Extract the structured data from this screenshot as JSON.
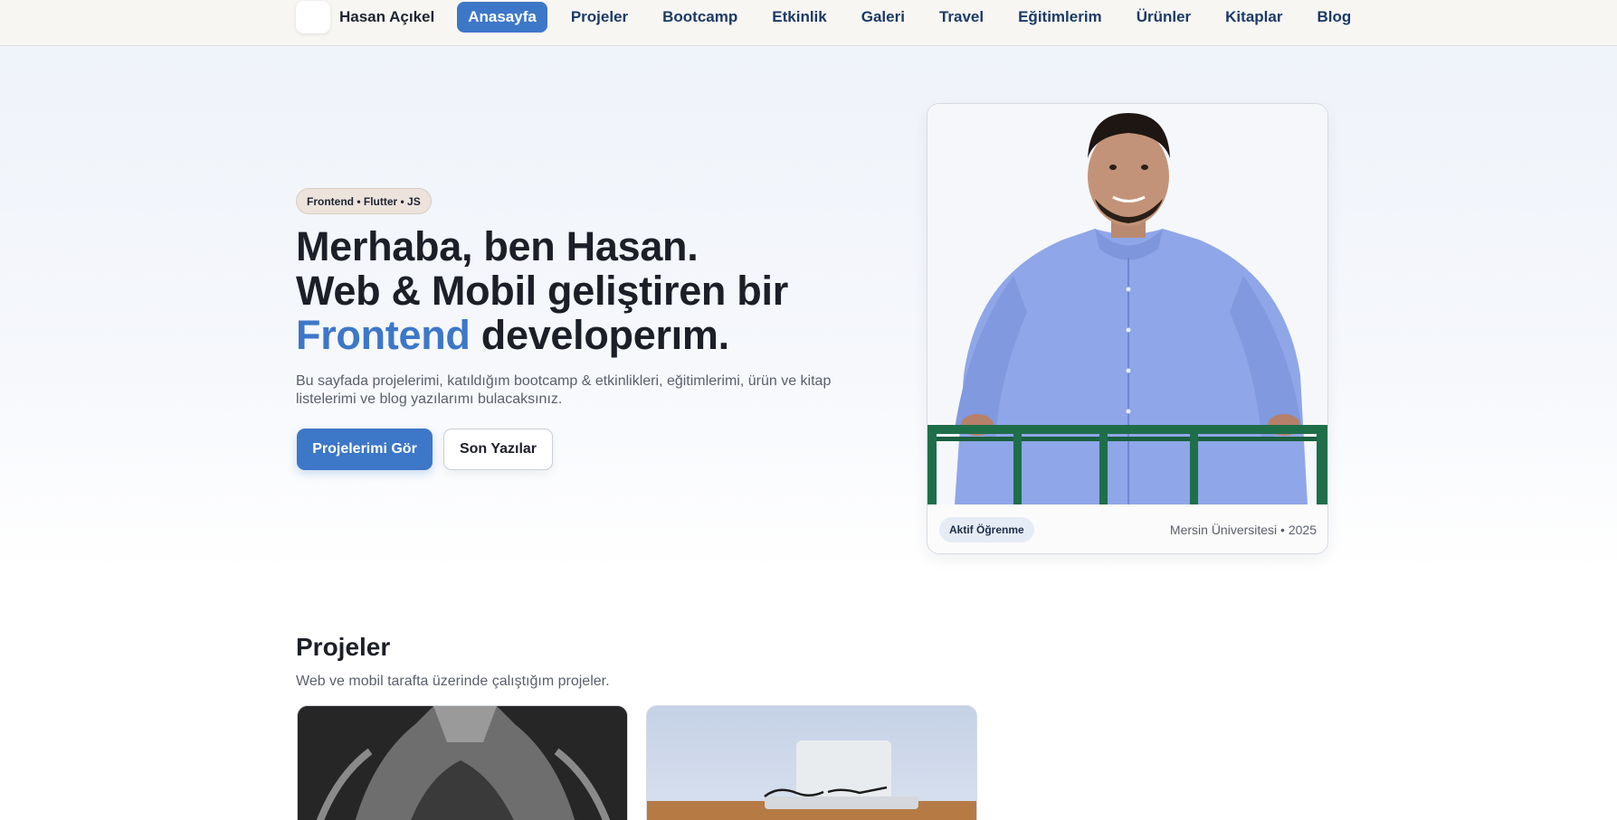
{
  "nav": {
    "brand": "Hasan Açıkel",
    "links": [
      "Anasayfa",
      "Projeler",
      "Bootcamp",
      "Etkinlik",
      "Galeri",
      "Travel",
      "Eğitimlerim",
      "Ürünler",
      "Kitaplar",
      "Blog"
    ],
    "active_index": 0
  },
  "hero": {
    "badge": "Frontend • Flutter • JS",
    "title_line1": "Merhaba, ben Hasan.",
    "title_line2": "Web & Mobil geliştiren bir",
    "title_accent": "Frontend",
    "title_rest": " developerım.",
    "description": "Bu sayfada projelerimi, katıldığım bootcamp & etkinlikleri, eğitimlerimi, ürün ve kitap listelerimi ve blog yazılarımı bulacaksınız.",
    "primary_button": "Projelerimi Gör",
    "secondary_button": "Son Yazılar"
  },
  "profile_card": {
    "chip": "Aktif Öğrenme",
    "meta": "Mersin Üniversitesi • 2025"
  },
  "projects": {
    "title": "Projeler",
    "subtitle": "Web ve mobil tarafta üzerinde çalıştığım projeler."
  },
  "colors": {
    "accent": "#3d77c8",
    "nav_text": "#1c3a66"
  }
}
